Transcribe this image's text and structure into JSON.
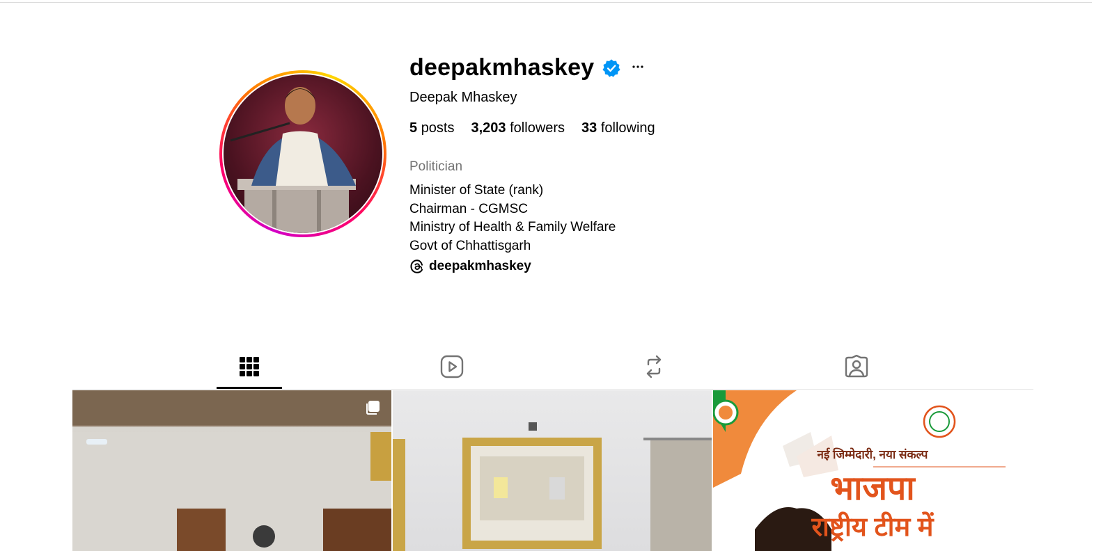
{
  "profile": {
    "username": "deepakmhaskey",
    "full_name": "Deepak Mhaskey",
    "verified": true,
    "stats": {
      "posts_count": "5",
      "posts_label": "posts",
      "followers_count": "3,203",
      "followers_label": "followers",
      "following_count": "33",
      "following_label": "following"
    },
    "category": "Politician",
    "bio": [
      "Minister of State (rank)",
      "Chairman - CGMSC",
      "Ministry of Health & Family Welfare",
      "Govt of Chhattisgarh"
    ],
    "threads_handle": "deepakmhaskey"
  },
  "tabs": [
    {
      "id": "posts",
      "icon": "grid-icon",
      "active": true
    },
    {
      "id": "reels",
      "icon": "reels-icon",
      "active": false
    },
    {
      "id": "reposts",
      "icon": "repost-icon",
      "active": false
    },
    {
      "id": "tagged",
      "icon": "tagged-icon",
      "active": false
    }
  ],
  "posts_grid": {
    "post3_text": {
      "line1": "नई जिम्मेदारी, नया संकल्प",
      "line2": "भाजपा",
      "line3": "राष्ट्रीय टीम में"
    }
  },
  "colors": {
    "verified_blue": "#0095f6",
    "muted_text": "#737373",
    "saffron": "#e2541c"
  }
}
